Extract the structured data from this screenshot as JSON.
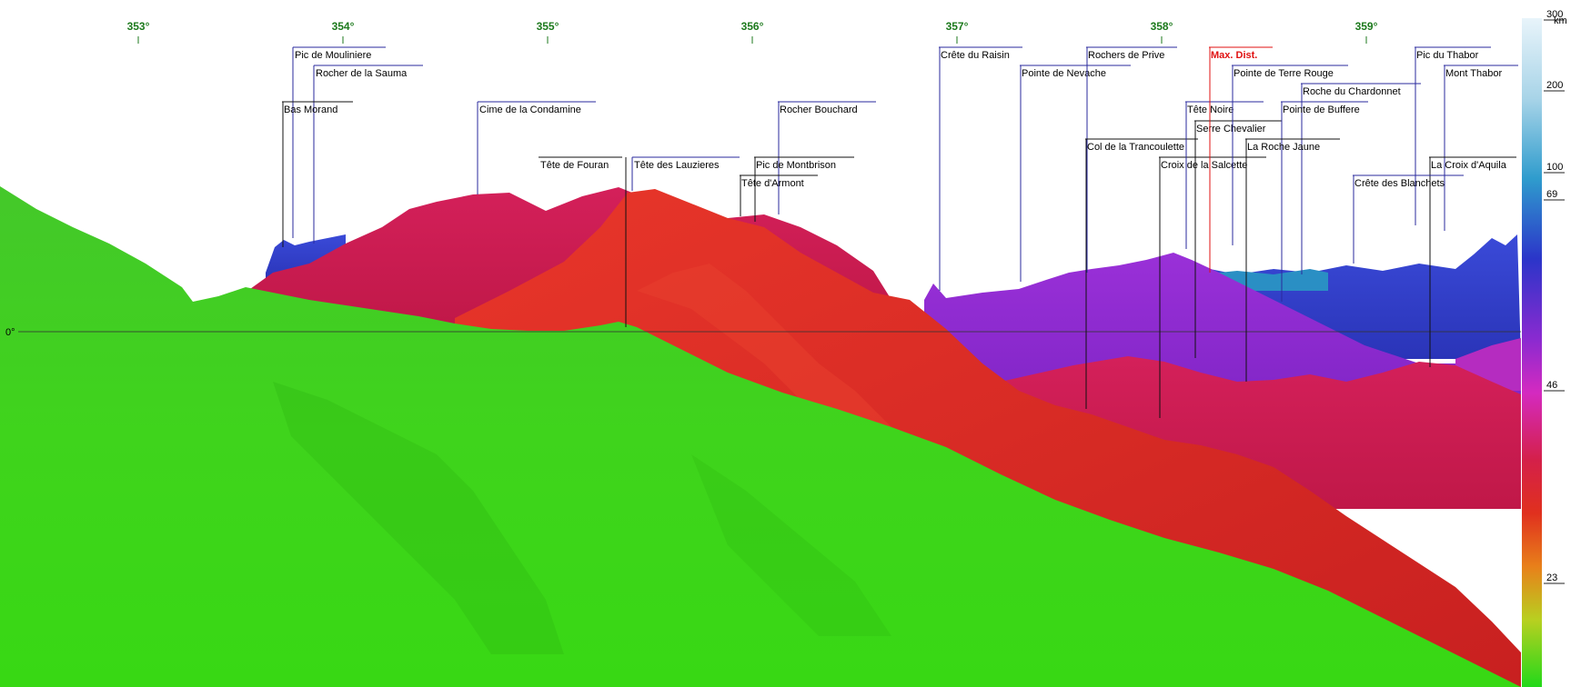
{
  "bearings": [
    "353°",
    "354°",
    "355°",
    "356°",
    "357°",
    "358°",
    "359°"
  ],
  "horizon_label": "0°",
  "peaks": [
    {
      "name": "Pic de Mouliniere",
      "kind": "peak"
    },
    {
      "name": "Rocher de la Sauma",
      "kind": "peak"
    },
    {
      "name": "Bas Morand",
      "kind": "peak"
    },
    {
      "name": "Cime de la Condamine",
      "kind": "peak"
    },
    {
      "name": "Tête de Fouran",
      "kind": "peak"
    },
    {
      "name": "Tête des Lauzieres",
      "kind": "peak"
    },
    {
      "name": "Rocher Bouchard",
      "kind": "peak"
    },
    {
      "name": "Pic de Montbrison",
      "kind": "peak"
    },
    {
      "name": "Tête d'Armont",
      "kind": "peak"
    },
    {
      "name": "Crête du Raisin",
      "kind": "peak"
    },
    {
      "name": "Pointe de Nevache",
      "kind": "peak"
    },
    {
      "name": "Rochers de Prive",
      "kind": "peak"
    },
    {
      "name": "Col de la Trancoulette",
      "kind": "peak"
    },
    {
      "name": "Croix de la Salcette",
      "kind": "peak"
    },
    {
      "name": "Tête Noire",
      "kind": "peak"
    },
    {
      "name": "Serre Chevalier",
      "kind": "peak"
    },
    {
      "name": "Max. Dist.",
      "kind": "maxdist"
    },
    {
      "name": "Pointe de Terre Rouge",
      "kind": "peak"
    },
    {
      "name": "Roche du Chardonnet",
      "kind": "peak"
    },
    {
      "name": "Pointe de Buffere",
      "kind": "peak"
    },
    {
      "name": "La Roche Jaune",
      "kind": "peak"
    },
    {
      "name": "Pic du Thabor",
      "kind": "peak"
    },
    {
      "name": "Mont Thabor",
      "kind": "peak"
    },
    {
      "name": "La Croix d'Aquila",
      "kind": "peak"
    },
    {
      "name": "Crête des Blanchets",
      "kind": "peak"
    }
  ],
  "distance_scale": {
    "unit": "km",
    "ticks": [
      "300",
      "200",
      "100",
      "69",
      "46",
      "23"
    ]
  },
  "colors": {
    "bearing_labels": "#1d7a1d",
    "peak_line_blue": "#2a2a9e",
    "max_dist": "#e01010",
    "near_terrain": "#3fcc1f",
    "mid_terrain": "#d42a2a",
    "far_terrain": "#8a2ad0"
  }
}
